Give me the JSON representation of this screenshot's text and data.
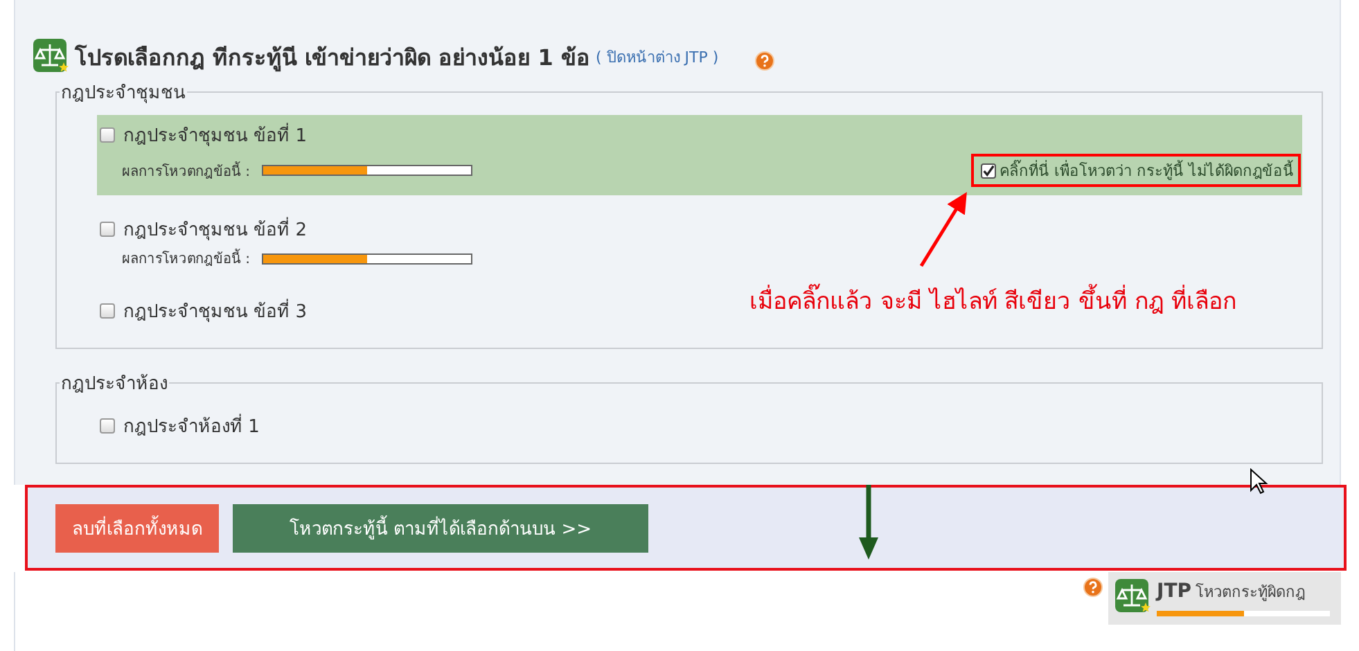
{
  "header": {
    "title": "โปรดเลือกกฎ ทีกระทู้นี เข้าข่ายว่าผิด อย่างน้อย 1 ข้อ",
    "close_link": "( ปิดหน้าต่าง JTP )"
  },
  "groups": [
    {
      "legend": "กฎประจำชุมชน",
      "rules": [
        {
          "label": "กฎประจำชุมชน ข้อที่ 1",
          "checked": false,
          "selected": true,
          "vote_label": "ผลการโหวตกฎข้อนี้ :",
          "level": 0.5,
          "confirm": {
            "label": "คลิ๊กที่นี่ เพื่อโหวตว่า กระทู้นี้ ไม่ได้ผิดกฎข้อนี้",
            "checked": true
          }
        },
        {
          "label": "กฎประจำชุมชน ข้อที่ 2",
          "checked": false,
          "selected": false,
          "vote_label": "ผลการโหวตกฎข้อนี้ :",
          "level": 0.5
        },
        {
          "label": "กฎประจำชุมชน ข้อที่ 3",
          "checked": false,
          "selected": false
        }
      ]
    },
    {
      "legend": "กฎประจำห้อง",
      "rules": [
        {
          "label": "กฎประจำห้องที่ 1",
          "checked": false,
          "selected": false
        }
      ]
    }
  ],
  "annotation": {
    "text": "เมื่อคลิ๊กแล้ว จะมี ไฮไลท์ สีเขียว ขึ้นที่ กฎ ที่เลือก"
  },
  "actions": [
    {
      "label": "ลบที่เลือกทั้งหมด",
      "kind": "danger"
    },
    {
      "label": "โหวตกระทู้นี้ ตามที่ได้เลือกด้านบน >>",
      "kind": "primary"
    }
  ],
  "widget": {
    "brand": "JTP",
    "label": "โหวตกระทู้ผิดกฎ",
    "level": 0.5
  }
}
